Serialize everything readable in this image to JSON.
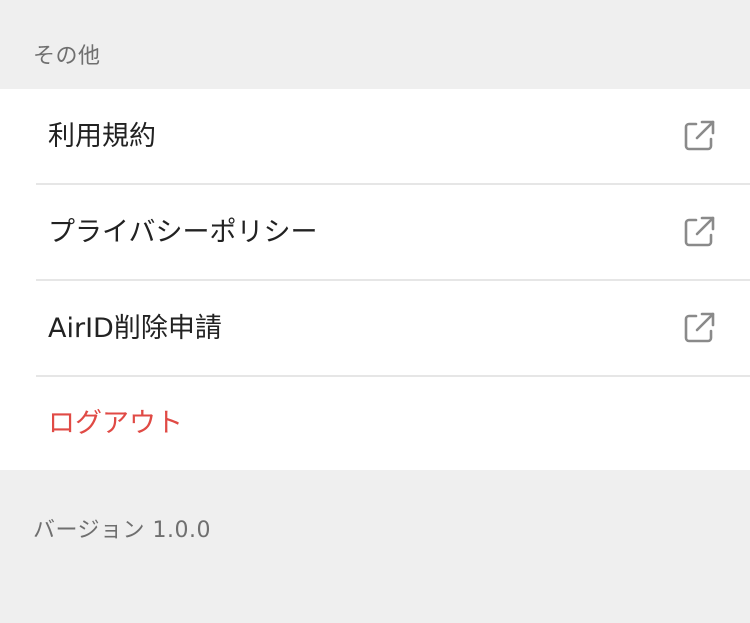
{
  "section": {
    "title": "その他"
  },
  "menu": {
    "items": [
      {
        "label": "利用規約",
        "icon": "external-link-icon"
      },
      {
        "label": "プライバシーポリシー",
        "icon": "external-link-icon"
      },
      {
        "label": "AirID削除申請",
        "icon": "external-link-icon"
      },
      {
        "label": "ログアウト"
      }
    ]
  },
  "footer": {
    "version": "バージョン 1.0.0"
  },
  "colors": {
    "background": "#efefef",
    "card": "#ffffff",
    "divider": "#e6e6e6",
    "text": "#222222",
    "muted": "#6f6f6f",
    "danger": "#e04a45",
    "icon": "#8a8a8a"
  }
}
